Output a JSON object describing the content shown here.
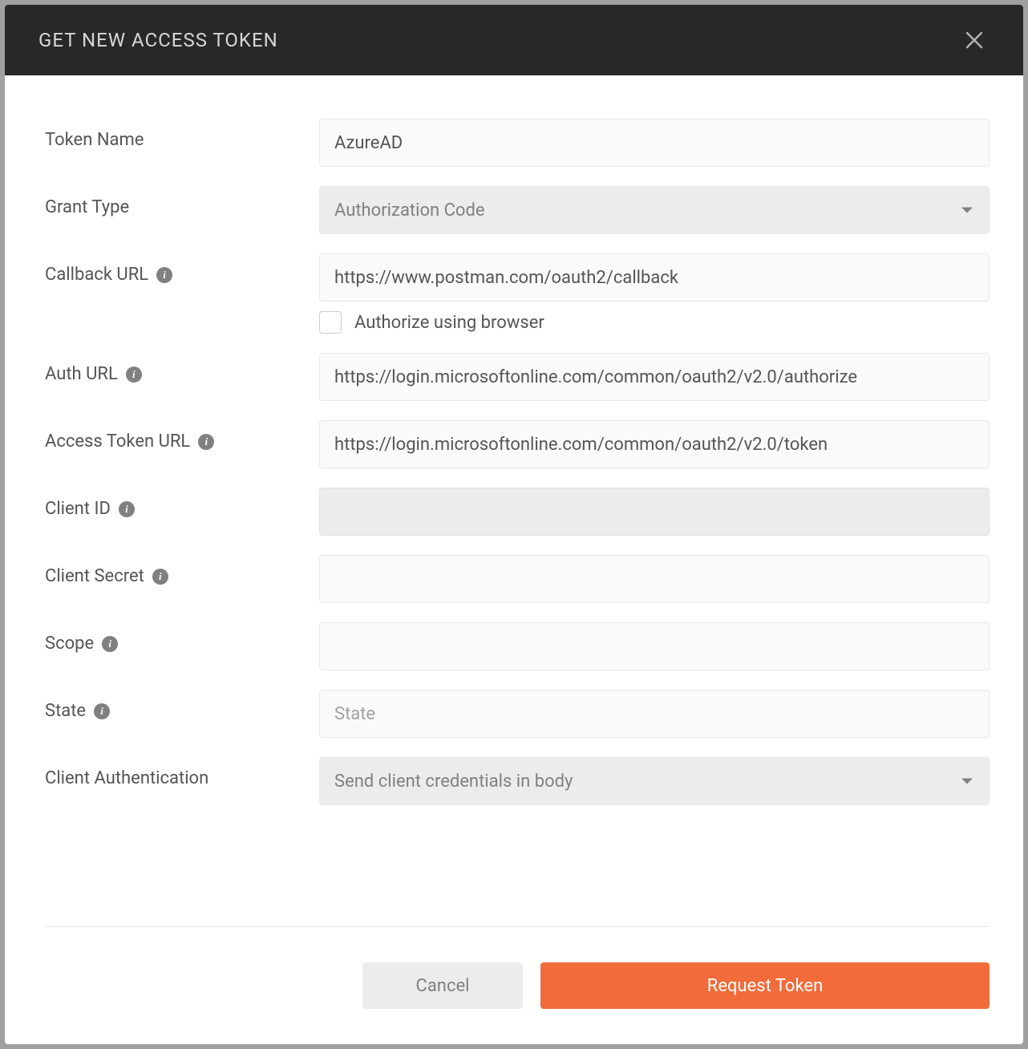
{
  "header": {
    "title": "GET NEW ACCESS TOKEN"
  },
  "labels": {
    "token_name": "Token Name",
    "grant_type": "Grant Type",
    "callback_url": "Callback URL",
    "authorize_browser": "Authorize using browser",
    "auth_url": "Auth URL",
    "access_token_url": "Access Token URL",
    "client_id": "Client ID",
    "client_secret": "Client Secret",
    "scope": "Scope",
    "state": "State",
    "client_authentication": "Client Authentication"
  },
  "values": {
    "token_name": "AzureAD",
    "grant_type": "Authorization Code",
    "callback_url": "https://www.postman.com/oauth2/callback",
    "auth_url": "https://login.microsoftonline.com/common/oauth2/v2.0/authorize",
    "access_token_url": "https://login.microsoftonline.com/common/oauth2/v2.0/token",
    "client_id": "",
    "client_secret": "",
    "scope": "",
    "state": "",
    "client_authentication": "Send client credentials in body"
  },
  "placeholders": {
    "state": "State"
  },
  "buttons": {
    "cancel": "Cancel",
    "request_token": "Request Token"
  }
}
